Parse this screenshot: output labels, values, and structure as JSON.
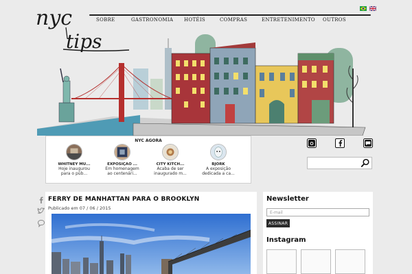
{
  "site": {
    "logo_text_top": "nyc",
    "logo_text_bottom": "tips"
  },
  "nav": {
    "items": [
      "SOBRE",
      "GASTRONOMIA",
      "HOTÉIS",
      "COMPRAS",
      "ENTRETENIMENTO",
      "OUTROS"
    ]
  },
  "languages": [
    {
      "code": "pt-BR",
      "icon": "brazil-flag-icon"
    },
    {
      "code": "en",
      "icon": "uk-flag-icon"
    }
  ],
  "agora": {
    "title": "NYC AGORA",
    "items": [
      {
        "name": "WHITNEY MU...",
        "text": "Hoje inaugurou para o púb..."
      },
      {
        "name": "EXPOSIÇÃO ...",
        "text": "Em homenagem ao centenári..."
      },
      {
        "name": "CITY KITCH...",
        "text": "Acaba de ser inaugurado m..."
      },
      {
        "name": "BJÖRK",
        "text": "A exposição dedicada a ca..."
      }
    ]
  },
  "social": [
    "instagram-icon",
    "facebook-icon",
    "chat-icon"
  ],
  "search": {
    "placeholder": "",
    "value": ""
  },
  "article": {
    "title": "FERRY DE MANHATTAN PARA O BROOKLYN",
    "meta": "Publicado em 07 / 06 / 2015"
  },
  "sidebar": {
    "newsletter_heading": "Newsletter",
    "email_placeholder": "E-mail",
    "subscribe_label": "ASSINAR",
    "instagram_heading": "Instagram"
  },
  "colors": {
    "background": "#ebebeb",
    "panel": "#ffffff",
    "text": "#222222",
    "button": "#2a2a2a"
  }
}
